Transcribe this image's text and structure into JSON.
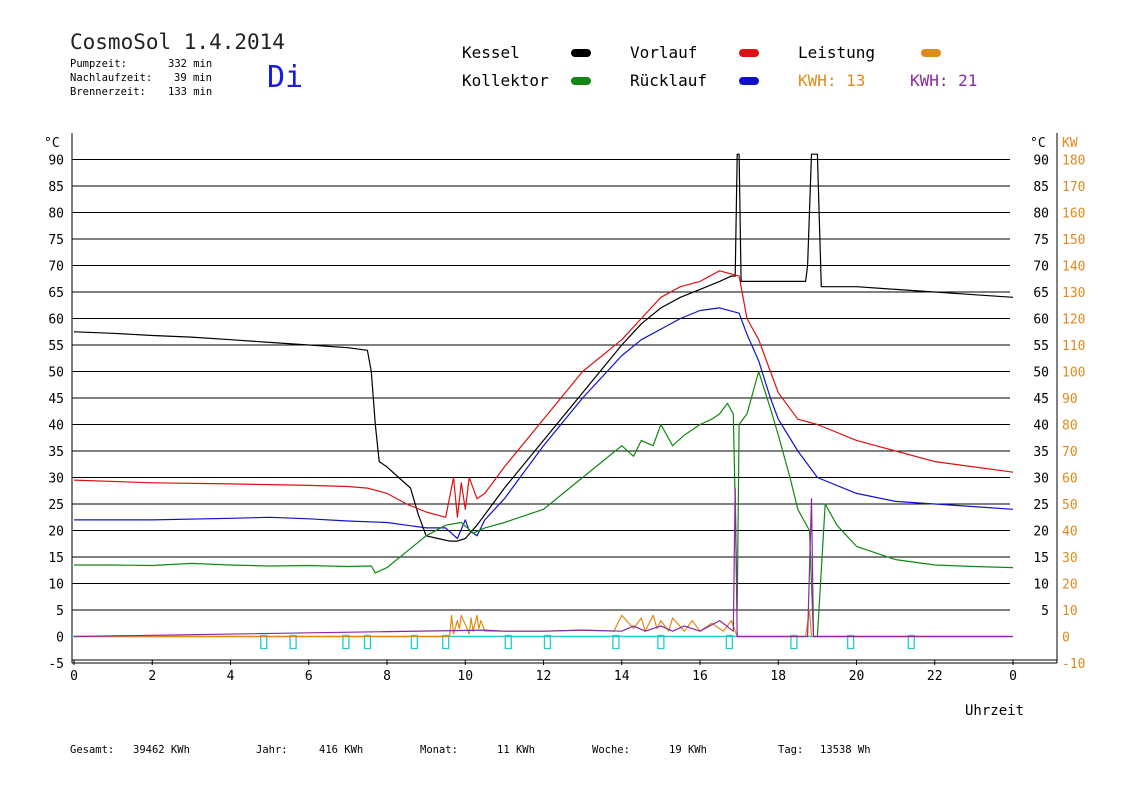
{
  "header": {
    "title": "CosmoSol 1.4.2014",
    "pump_label": "Pumpzeit:",
    "pump_value": "332 min",
    "nachlauf_label": "Nachlaufzeit:",
    "nachlauf_value": "39 min",
    "brenner_label": "Brennerzeit:",
    "brenner_value": "133 min",
    "day": "Di"
  },
  "legend": {
    "kessel": "Kessel",
    "kollektor": "Kollektor",
    "vorlauf": "Vorlauf",
    "ruecklauf": "Rücklauf",
    "leistung": "Leistung",
    "kwh1": "KWH: 13",
    "kwh2": "KWH: 21"
  },
  "footer": {
    "gesamt_label": "Gesamt:",
    "gesamt_value": "39462 KWh",
    "jahr_label": "Jahr:",
    "jahr_value": "416 KWh",
    "monat_label": "Monat:",
    "monat_value": "11 KWh",
    "woche_label": "Woche:",
    "woche_value": "19 KWh",
    "tag_label": "Tag:",
    "tag_value": "13538 Wh"
  },
  "colors": {
    "kessel": "#000000",
    "kollektor": "#118811",
    "vorlauf": "#dd1111",
    "ruecklauf": "#1111cc",
    "leistung": "#e08a1a",
    "leistung2": "#8a2aa0",
    "pump": "#22cccc"
  },
  "chart_data": {
    "type": "line",
    "title": "",
    "xlabel": "Uhrzeit",
    "ylabel_left": "°C",
    "ylabel_right_1": "°C",
    "ylabel_right_2": "KW",
    "xlim": [
      0,
      24
    ],
    "ylim": [
      -5,
      95
    ],
    "y2lim": [
      -10,
      190
    ],
    "x_tick_labels": [
      "0",
      "2",
      "4",
      "6",
      "8",
      "10",
      "12",
      "14",
      "16",
      "18",
      "20",
      "22",
      "0"
    ],
    "y_tick_labels": [
      "-5",
      "0",
      "5",
      "10",
      "15",
      "20",
      "25",
      "30",
      "35",
      "40",
      "45",
      "50",
      "55",
      "60",
      "65",
      "70",
      "75",
      "80",
      "85",
      "90"
    ],
    "y_right_tick_labels": [
      "5",
      "10",
      "15",
      "20",
      "25",
      "30",
      "35",
      "40",
      "45",
      "50",
      "55",
      "60",
      "65",
      "70",
      "75",
      "80",
      "85",
      "90"
    ],
    "y2_tick_labels": [
      "-10",
      "0",
      "10",
      "20",
      "30",
      "40",
      "50",
      "60",
      "70",
      "80",
      "90",
      "100",
      "110",
      "120",
      "130",
      "140",
      "150",
      "160",
      "170",
      "180"
    ],
    "series": [
      {
        "name": "Kessel",
        "color": "#000000",
        "x": [
          0,
          1,
          2,
          3,
          4,
          5,
          6,
          7,
          7.5,
          7.6,
          7.7,
          7.8,
          8.0,
          8.3,
          8.6,
          8.8,
          9.0,
          9.3,
          9.6,
          9.8,
          10.0,
          10.3,
          10.5,
          11,
          12,
          13,
          14,
          14.5,
          15,
          15.5,
          16,
          16.5,
          16.8,
          16.9,
          16.95,
          17.0,
          17.05,
          17.1,
          17.5,
          18.0,
          18.7,
          18.75,
          18.85,
          18.9,
          19.0,
          19.1,
          20,
          21,
          22,
          23,
          24
        ],
        "y": [
          57.5,
          57.2,
          56.8,
          56.5,
          56,
          55.5,
          55,
          54.5,
          54,
          50,
          40,
          33,
          32,
          30,
          28,
          23,
          19,
          18.5,
          18,
          18,
          18.5,
          21,
          23,
          28,
          37,
          46,
          55,
          59,
          62,
          64,
          65.5,
          67,
          68,
          68,
          91,
          91,
          67,
          67,
          67,
          67,
          67,
          70,
          91,
          91,
          91,
          66,
          66,
          65.5,
          65,
          64.5,
          64
        ]
      },
      {
        "name": "Vorlauf",
        "color": "#dd1111",
        "x": [
          0,
          2,
          4,
          6,
          7,
          7.5,
          8,
          8.5,
          9,
          9.5,
          9.7,
          9.8,
          9.9,
          10.0,
          10.1,
          10.3,
          10.5,
          11,
          12,
          13,
          14,
          14.5,
          15,
          15.5,
          16,
          16.5,
          17,
          17.2,
          17.5,
          17.8,
          18.0,
          18.5,
          19,
          20,
          21,
          22,
          23,
          24
        ],
        "y": [
          29.5,
          29,
          28.8,
          28.5,
          28.3,
          28,
          27,
          25,
          23.5,
          22.5,
          30,
          22.5,
          29,
          24,
          30,
          26,
          27,
          32,
          41,
          50,
          56,
          60,
          64,
          66,
          67,
          69,
          68,
          60,
          56,
          50,
          46,
          41,
          40,
          37,
          35,
          33,
          32,
          31
        ]
      },
      {
        "name": "Rücklauf",
        "color": "#1111cc",
        "x": [
          0,
          2,
          4,
          5,
          6,
          7,
          8,
          8.5,
          9,
          9.5,
          9.8,
          10.0,
          10.1,
          10.3,
          10.5,
          11,
          12,
          13,
          14,
          14.5,
          15,
          15.5,
          16,
          16.5,
          17,
          17.2,
          17.5,
          17.8,
          18.0,
          18.5,
          19,
          20,
          21,
          22,
          23,
          24
        ],
        "y": [
          22,
          22,
          22.3,
          22.5,
          22.2,
          21.8,
          21.5,
          21,
          20.5,
          20.5,
          18.5,
          22,
          20,
          19,
          22,
          26,
          36,
          45,
          53,
          56,
          58,
          60,
          61.5,
          62,
          61,
          57,
          52,
          45,
          41,
          35,
          30,
          27,
          25.5,
          25,
          24.5,
          24
        ]
      },
      {
        "name": "Kollektor",
        "color": "#118811",
        "x": [
          0,
          1,
          2,
          3,
          4,
          5,
          6,
          7,
          7.6,
          7.7,
          8.0,
          8.5,
          9,
          9.5,
          9.9,
          10.2,
          10.5,
          11,
          12,
          12.5,
          13,
          13.5,
          14,
          14.3,
          14.5,
          14.8,
          15,
          15.3,
          15.6,
          16,
          16.3,
          16.5,
          16.7,
          16.85,
          16.9,
          16.95,
          17.0,
          17.2,
          17.5,
          17.8,
          18.0,
          18.3,
          18.5,
          18.8,
          18.9,
          19.0,
          19.2,
          19.5,
          20,
          21,
          22,
          23,
          24
        ],
        "y": [
          13.5,
          13.5,
          13.4,
          13.8,
          13.5,
          13.3,
          13.4,
          13.2,
          13.3,
          12,
          13,
          16,
          19,
          21,
          21.5,
          19.5,
          20.5,
          21.5,
          24,
          27,
          30,
          33,
          36,
          34,
          37,
          36,
          40,
          36,
          38,
          40,
          41,
          42,
          44,
          42,
          25,
          5,
          40,
          42,
          50,
          43,
          38,
          30,
          24,
          20,
          0,
          0,
          25,
          21,
          17,
          14.5,
          13.5,
          13.2,
          13
        ]
      },
      {
        "name": "Leistung",
        "color": "#e08a1a",
        "x": [
          0,
          9.6,
          9.65,
          9.7,
          9.8,
          9.85,
          9.9,
          10.1,
          10.15,
          10.2,
          10.3,
          10.35,
          10.4,
          10.5,
          11,
          12,
          13,
          13.8,
          14,
          14.3,
          14.5,
          14.6,
          14.8,
          14.9,
          15.0,
          15.2,
          15.3,
          15.6,
          15.8,
          16,
          16.3,
          16.6,
          16.8,
          16.9,
          16.95,
          17.0,
          17.5,
          18.7,
          18.8,
          18.85,
          19.0,
          19.1,
          24
        ],
        "y": [
          0,
          0,
          4,
          0.5,
          3,
          1.5,
          4,
          0.5,
          3.5,
          1,
          4,
          1.5,
          3,
          1,
          1,
          1,
          1.2,
          1,
          4,
          1.5,
          3.5,
          1,
          4,
          1.5,
          3,
          1,
          3.5,
          1,
          3,
          1,
          2.5,
          1,
          3,
          1,
          0,
          0,
          0,
          0,
          5,
          0,
          0,
          0,
          0
        ]
      },
      {
        "name": "Leistung 2",
        "color": "#8a2aa0",
        "x": [
          0,
          10.5,
          11,
          12,
          13,
          14,
          14.3,
          14.6,
          15,
          15.3,
          15.6,
          16,
          16.5,
          16.85,
          16.9,
          16.95,
          17.0,
          18.75,
          18.85,
          18.9,
          19.0,
          24
        ],
        "y": [
          0,
          1.2,
          1,
          1,
          1.2,
          1,
          2,
          1,
          2,
          1,
          2,
          1,
          3,
          1,
          28,
          0,
          0,
          0,
          26,
          0,
          0,
          0
        ]
      }
    ],
    "pump_markers_hours": [
      4.85,
      5.6,
      6.95,
      7.5,
      8.7,
      9.5,
      11.1,
      12.1,
      13.85,
      15.0,
      16.75,
      18.4,
      19.85,
      21.4
    ],
    "grid": true,
    "legend_position": "top"
  }
}
